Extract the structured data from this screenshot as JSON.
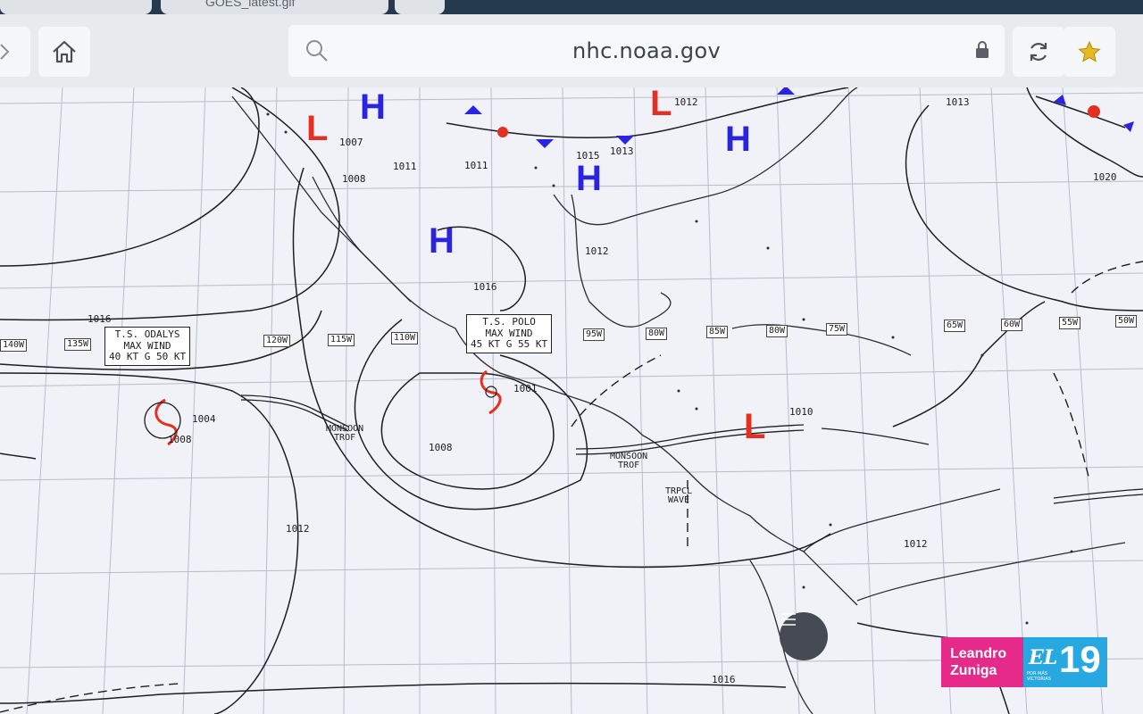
{
  "browser": {
    "tab_title": "GOES_latest.gif",
    "url": "nhc.noaa.gov",
    "icons": [
      "back-arrow-icon",
      "home-icon",
      "search-icon",
      "lock-icon",
      "reload-icon",
      "star-icon"
    ]
  },
  "map": {
    "systems": [
      {
        "id": "ts-polo",
        "lines": [
          "T.S. POLO",
          "MAX WIND",
          "45 KT G 55 KT"
        ]
      },
      {
        "id": "ts-odalys",
        "lines": [
          "T.S. ODALYS",
          "MAX WIND",
          "40 KT G 50 KT"
        ]
      }
    ],
    "longitudes": [
      "140W",
      "135W",
      "120W",
      "115W",
      "110W",
      "95W",
      "80W",
      "85W",
      "80W",
      "75W",
      "65W",
      "60W",
      "55W",
      "50W"
    ],
    "isobars": [
      "1016",
      "1016",
      "1008",
      "1012",
      "1012",
      "1013",
      "1020",
      "1010",
      "1001",
      "1004",
      "1008",
      "1008",
      "1012",
      "1016",
      "1007",
      "1011",
      "1011",
      "1015",
      "1013",
      "1012",
      "1012"
    ],
    "annotations": {
      "monsoon_trof_west": [
        "MONSOON",
        "TROF"
      ],
      "monsoon_trof_east": [
        "MONSOON",
        "TROF"
      ],
      "tropical_wave": [
        "TRPCL",
        "WAVE"
      ]
    },
    "symbol_letters": {
      "high": "H",
      "low": "L"
    }
  },
  "watermark": {
    "name_line1": "Leandro",
    "name_line2": "Zuniga",
    "channel_prefix": "EL",
    "channel_number": "19",
    "tagline": "POR MÁS VICTORIAS"
  },
  "colors": {
    "high": "#2a24e0",
    "low": "#e33022",
    "brand_pink": "#e62a8a",
    "brand_blue": "#27a8e0"
  }
}
